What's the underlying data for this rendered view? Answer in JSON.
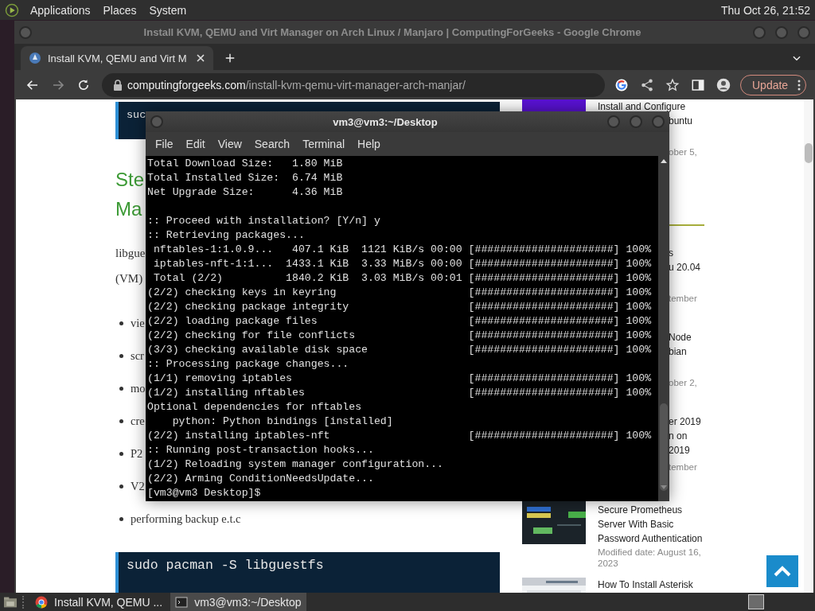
{
  "top_panel": {
    "menus": [
      "Applications",
      "Places",
      "System"
    ],
    "clock": "Thu Oct 26, 21:52"
  },
  "browser": {
    "title": "Install KVM, QEMU and Virt Manager on Arch Linux / Manjaro | ComputingForGeeks - Google Chrome",
    "tabs": [
      {
        "label": "Install KVM, QEMU and Virt M",
        "selected": true
      }
    ],
    "url": {
      "host": "computingforgeeks.com",
      "path": "/install-kvm-qemu-virt-manager-arch-manjar/"
    },
    "update_button": "Update",
    "article": {
      "code_top": "suc",
      "heading": [
        "Ste",
        "Ma"
      ],
      "paragraph": [
        "libgue",
        "(VM)"
      ],
      "bullets": [
        "vie",
        "scr",
        "mo",
        "cre",
        "P2",
        "V2",
        "performing backup e.t.c"
      ],
      "code_bottom": "sudo pacman -S libguestfs"
    },
    "sidebar": {
      "posts": [
        {
          "thumbnail": {
            "kind": "picture"
          },
          "title": [
            {
              "kind": "line",
              "text": "Install and Configure"
            },
            {
              "kind": "fragment",
              "text": "buntu"
            }
          ],
          "date": [
            "ober 5,"
          ]
        },
        {
          "title": [
            {
              "kind": "fragment",
              "text": "s"
            },
            {
              "kind": "fragment",
              "text": "u 20.04"
            }
          ],
          "date": [
            "tember"
          ]
        },
        {
          "title": [
            {
              "kind": "fragment",
              "text": "Node"
            },
            {
              "kind": "fragment",
              "text": "bian"
            }
          ],
          "date": [
            "ober 2,"
          ]
        },
        {
          "title": [
            {
              "kind": "fragment",
              "text": "er 2019"
            },
            {
              "kind": "fragment",
              "text": "n on"
            },
            {
              "kind": "fragment",
              "text": "2019"
            }
          ],
          "date": [
            "tember"
          ]
        },
        {
          "thumbnail": {
            "kind": "picture"
          },
          "title": [
            {
              "kind": "line",
              "text": "Secure Prometheus"
            },
            {
              "kind": "line",
              "text": "Server With Basic"
            },
            {
              "kind": "line",
              "text": "Password Authentication"
            }
          ],
          "date": [
            "Modified date: August 16,",
            "2023"
          ]
        },
        {
          "thumbnail": {
            "kind": "picture"
          },
          "title": [
            {
              "kind": "line",
              "text": "How To Install Asterisk"
            }
          ]
        }
      ]
    }
  },
  "terminal": {
    "title": "vm3@vm3:~/Desktop",
    "menus": [
      "File",
      "Edit",
      "View",
      "Search",
      "Terminal",
      "Help"
    ],
    "blocks": [
      [
        "Total Download Size:   1.80 MiB",
        "Total Installed Size:  6.74 MiB",
        "Net Upgrade Size:      4.36 MiB"
      ],
      [
        ":: Proceed with installation? [Y/n] y",
        ":: Retrieving packages...",
        " nftables-1:1.0.9...   407.1 KiB  1121 KiB/s 00:00 [######################] 100%",
        " iptables-nft-1:1...  1433.1 KiB  3.33 MiB/s 00:00 [######################] 100%",
        " Total (2/2)          1840.2 KiB  3.03 MiB/s 00:01 [######################] 100%",
        "(2/2) checking keys in keyring                     [######################] 100%",
        "(2/2) checking package integrity                   [######################] 100%",
        "(2/2) loading package files                        [######################] 100%",
        "(2/2) checking for file conflicts                  [######################] 100%",
        "(3/3) checking available disk space                [######################] 100%",
        ":: Processing package changes...",
        "(1/1) removing iptables                            [######################] 100%",
        "(1/2) installing nftables                          [######################] 100%",
        "Optional dependencies for nftables",
        "    python: Python bindings [installed]",
        "(2/2) installing iptables-nft                      [######################] 100%",
        ":: Running post-transaction hooks...",
        "(1/2) Reloading system manager configuration...",
        "(2/2) Arming ConditionNeedsUpdate...",
        "[vm3@vm3 Desktop]$"
      ]
    ]
  },
  "taskbar": {
    "items": [
      {
        "kind": "browser",
        "label": "Install KVM, QEMU ...",
        "selected": false
      },
      {
        "kind": "terminal",
        "label": "vm3@vm3:~/Desktop",
        "selected": true
      }
    ]
  }
}
